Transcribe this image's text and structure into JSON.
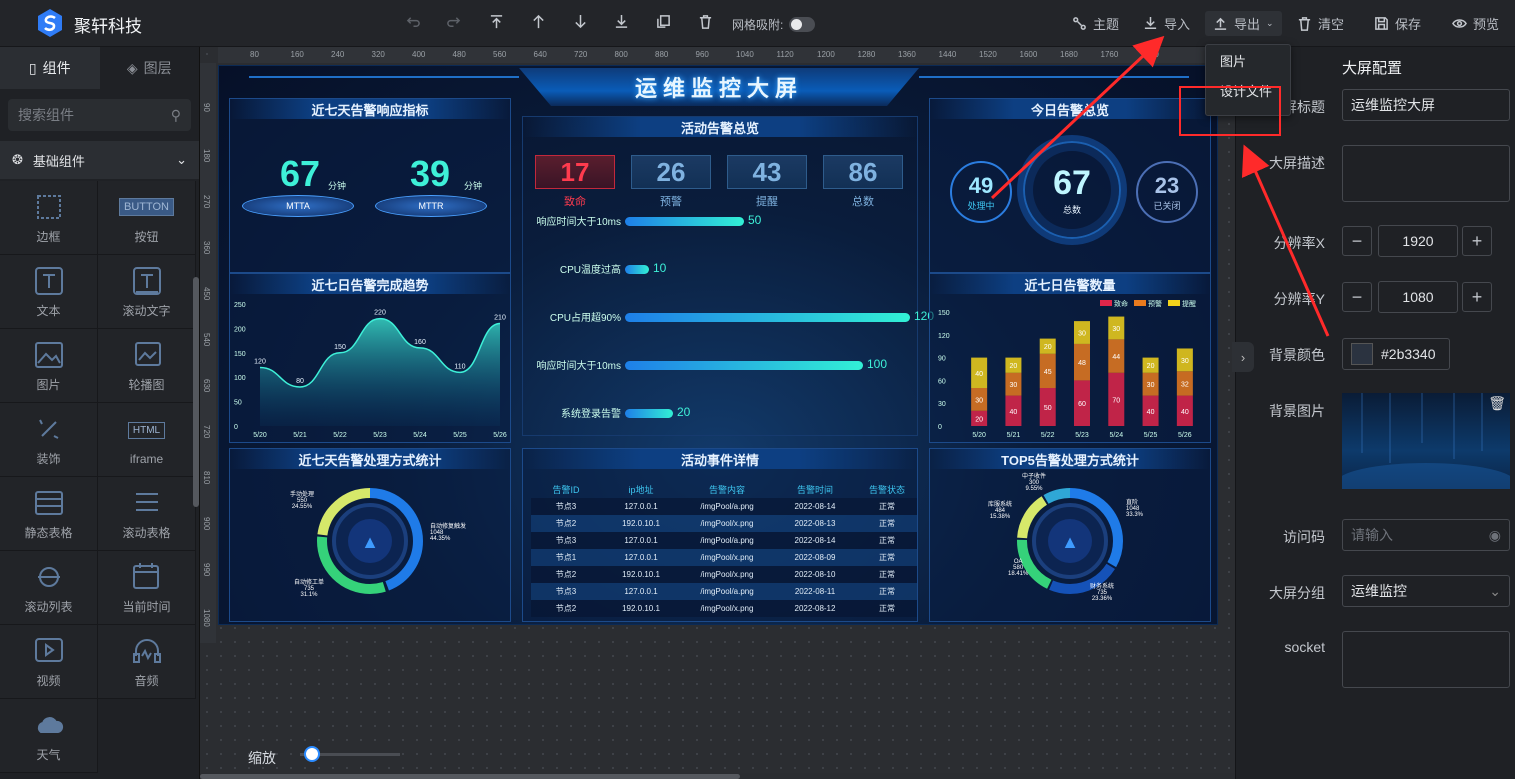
{
  "app": {
    "brand": "聚轩科技"
  },
  "toolbar": {
    "grid_snap_label": "网格吸附:",
    "theme": "主题",
    "import": "导入",
    "export": "导出",
    "clear": "清空",
    "save": "保存",
    "preview": "预览"
  },
  "export_menu": {
    "items": [
      "图片",
      "设计文件"
    ]
  },
  "left": {
    "tab_components": "组件",
    "tab_layers": "图层",
    "search_placeholder": "搜索组件",
    "category": "基础组件",
    "items": [
      {
        "label": "边框",
        "icon": "border-icon"
      },
      {
        "label": "按钮",
        "icon": "button-icon",
        "badge": "BUTTON"
      },
      {
        "label": "文本",
        "icon": "text-icon"
      },
      {
        "label": "滚动文字",
        "icon": "scroll-text-icon"
      },
      {
        "label": "图片",
        "icon": "image-icon"
      },
      {
        "label": "轮播图",
        "icon": "carousel-icon"
      },
      {
        "label": "装饰",
        "icon": "decoration-icon"
      },
      {
        "label": "iframe",
        "icon": "html-icon",
        "badge": "HTML"
      },
      {
        "label": "静态表格",
        "icon": "static-table-icon"
      },
      {
        "label": "滚动表格",
        "icon": "scroll-table-icon"
      },
      {
        "label": "滚动列表",
        "icon": "scroll-list-icon"
      },
      {
        "label": "当前时间",
        "icon": "calendar-icon"
      },
      {
        "label": "视频",
        "icon": "video-icon"
      },
      {
        "label": "音频",
        "icon": "audio-icon"
      },
      {
        "label": "天气",
        "icon": "weather-icon"
      }
    ]
  },
  "ruler": {
    "h": [
      "80",
      "160",
      "240",
      "320",
      "400",
      "480",
      "560",
      "640",
      "720",
      "800",
      "880",
      "960",
      "1040",
      "1120",
      "1200",
      "1280",
      "1360",
      "1440",
      "1520",
      "1600",
      "1680",
      "1760",
      "1840"
    ],
    "v": [
      "90",
      "180",
      "270",
      "360",
      "450",
      "540",
      "630",
      "720",
      "810",
      "900",
      "990",
      "1080"
    ]
  },
  "screen": {
    "title": "运维监控大屏",
    "p1": {
      "title": "近七天告警响应指标",
      "mtta": "67",
      "mtta_unit": "分钟",
      "mtta_label": "MTTA",
      "mttr": "39",
      "mttr_unit": "分钟",
      "mttr_label": "MTTR"
    },
    "p2": {
      "title": "活动告警总览",
      "kpis": [
        {
          "value": "17",
          "label": "致命",
          "color": "#ff3b4e"
        },
        {
          "value": "26",
          "label": "预警",
          "color": "#7fb2e0"
        },
        {
          "value": "43",
          "label": "提醒",
          "color": "#7fb2e0"
        },
        {
          "value": "86",
          "label": "总数",
          "color": "#7fb2e0"
        }
      ],
      "bars": [
        {
          "label": "响应时间大于10ms",
          "value": 50
        },
        {
          "label": "CPU温度过高",
          "value": 10
        },
        {
          "label": "CPU占用超90%",
          "value": 120
        },
        {
          "label": "响应时间大于10ms",
          "value": 100
        },
        {
          "label": "系统登录告警",
          "value": 20
        }
      ]
    },
    "p3": {
      "title": "今日告警总览",
      "processing": "49",
      "processing_label": "处理中",
      "total": "67",
      "total_label": "总数",
      "closed": "23",
      "closed_label": "已关闭"
    },
    "p4": {
      "title": "近七日告警完成趋势"
    },
    "p5": {
      "title": "近七日告警数量",
      "legend": [
        "致命",
        "预警",
        "提醒"
      ]
    },
    "p6": {
      "title": "近七天告警处理方式统计",
      "labels": [
        {
          "name": "手动处理",
          "value": "550",
          "pct": "24.55%"
        },
        {
          "name": "自动修复触发",
          "value": "1048",
          "pct": "44.35%"
        },
        {
          "name": "自动修工单",
          "value": "735",
          "pct": "31.1%"
        }
      ]
    },
    "p7": {
      "title": "活动事件详情",
      "headers": [
        "告警ID",
        "ip地址",
        "告警内容",
        "告警时间",
        "告警状态"
      ],
      "rows": [
        [
          "节点3",
          "127.0.0.1",
          "/imgPool/a.png",
          "2022-08-14",
          "正常"
        ],
        [
          "节点2",
          "192.0.10.1",
          "/imgPool/x.png",
          "2022-08-13",
          "正常"
        ],
        [
          "节点3",
          "127.0.0.1",
          "/imgPool/a.png",
          "2022-08-14",
          "正常"
        ],
        [
          "节点1",
          "127.0.0.1",
          "/imgPool/x.png",
          "2022-08-09",
          "正常"
        ],
        [
          "节点2",
          "192.0.10.1",
          "/imgPool/x.png",
          "2022-08-10",
          "正常"
        ],
        [
          "节点3",
          "127.0.0.1",
          "/imgPool/a.png",
          "2022-08-11",
          "正常"
        ],
        [
          "节点2",
          "192.0.10.1",
          "/imgPool/x.png",
          "2022-08-12",
          "正常"
        ]
      ]
    },
    "p8": {
      "title": "TOP5告警处理方式统计",
      "labels": [
        {
          "name": "中子收件",
          "value": "300",
          "pct": "9.55%"
        },
        {
          "name": "直阶",
          "value": "1048",
          "pct": "33.3%"
        },
        {
          "name": "库服系统",
          "value": "484",
          "pct": "15.38%"
        },
        {
          "name": "OA",
          "value": "580",
          "pct": "18.41%"
        },
        {
          "name": "财务系统",
          "value": "735",
          "pct": "23.36%"
        }
      ]
    }
  },
  "chart_data": [
    {
      "type": "area",
      "title": "近七日告警完成趋势",
      "categories": [
        "5/20",
        "5/21",
        "5/22",
        "5/23",
        "5/24",
        "5/25",
        "5/26"
      ],
      "values": [
        120,
        80,
        150,
        220,
        160,
        110,
        210
      ],
      "ylim": [
        0,
        250
      ],
      "yticks": [
        0,
        50,
        100,
        150,
        200,
        250
      ]
    },
    {
      "type": "bar",
      "stacked": true,
      "title": "近七日告警数量",
      "categories": [
        "5/20",
        "5/21",
        "5/22",
        "5/23",
        "5/24",
        "5/25",
        "5/26"
      ],
      "series": [
        {
          "name": "致命",
          "values": [
            20,
            40,
            50,
            60,
            70,
            40,
            40
          ]
        },
        {
          "name": "预警",
          "values": [
            30,
            30,
            45,
            48,
            44,
            30,
            32
          ]
        },
        {
          "name": "提醒",
          "values": [
            40,
            20,
            20,
            30,
            30,
            20,
            30
          ]
        }
      ],
      "ylim": [
        0,
        150
      ],
      "yticks": [
        0,
        30,
        60,
        90,
        120,
        150
      ],
      "colors": [
        "#e0264a",
        "#e87a1e",
        "#f2d21b"
      ]
    }
  ],
  "right": {
    "title": "大屏配置",
    "fields": {
      "title_label": "大屏标题",
      "title_value": "运维监控大屏",
      "desc_label": "大屏描述",
      "resx_label": "分辨率X",
      "resx": "1920",
      "resy_label": "分辨率Y",
      "resy": "1080",
      "bgcolor_label": "背景颜色",
      "bgcolor": "#2b3340",
      "bgimg_label": "背景图片",
      "code_label": "访问码",
      "code_placeholder": "请输入",
      "group_label": "大屏分组",
      "group": "运维监控",
      "socket_label": "socket"
    }
  },
  "zoom_label": "缩放"
}
